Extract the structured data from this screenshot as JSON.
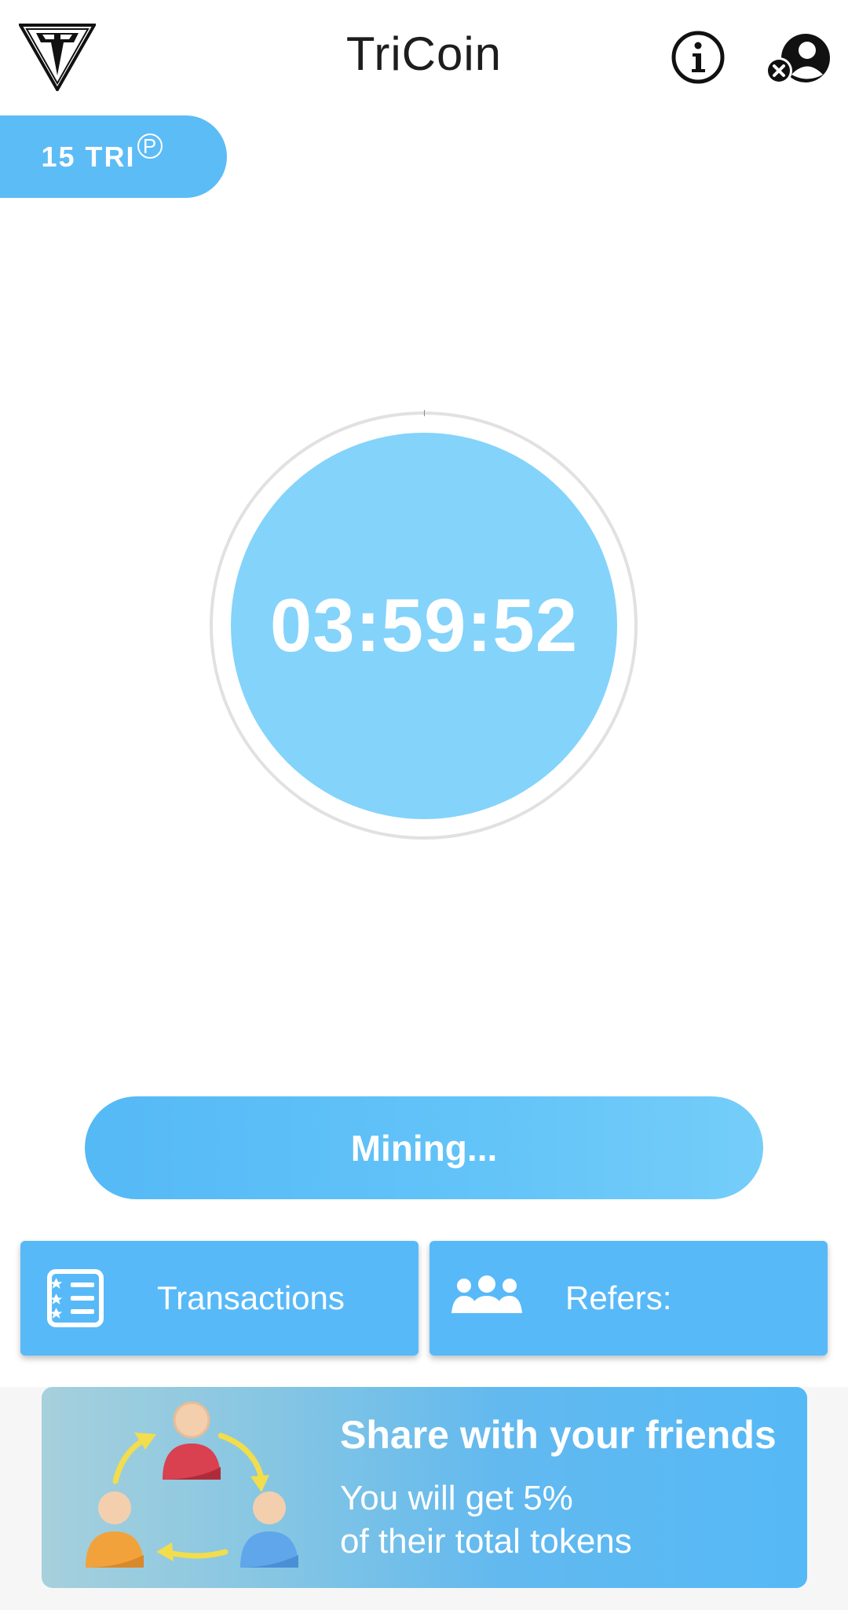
{
  "app": {
    "title": "TriCoin"
  },
  "balance": {
    "amount": "15 TRI",
    "symbol": "P"
  },
  "timer": {
    "remaining": "03:59:52"
  },
  "mining": {
    "label": "Mining..."
  },
  "actions": {
    "transactions_label": "Transactions",
    "refers_label": "Refers:"
  },
  "banner": {
    "title": "Share with your friends",
    "line1": "You will get 5%",
    "line2": "of their total tokens"
  },
  "colors": {
    "accent": "#58b9f8",
    "timer_fill": "#84d3fa",
    "ring": "#e1e1e1"
  },
  "icons": [
    "tricoin-logo-icon",
    "info-icon",
    "profile-remove-icon",
    "transactions-list-icon",
    "group-icon",
    "share-referral-illustration"
  ]
}
